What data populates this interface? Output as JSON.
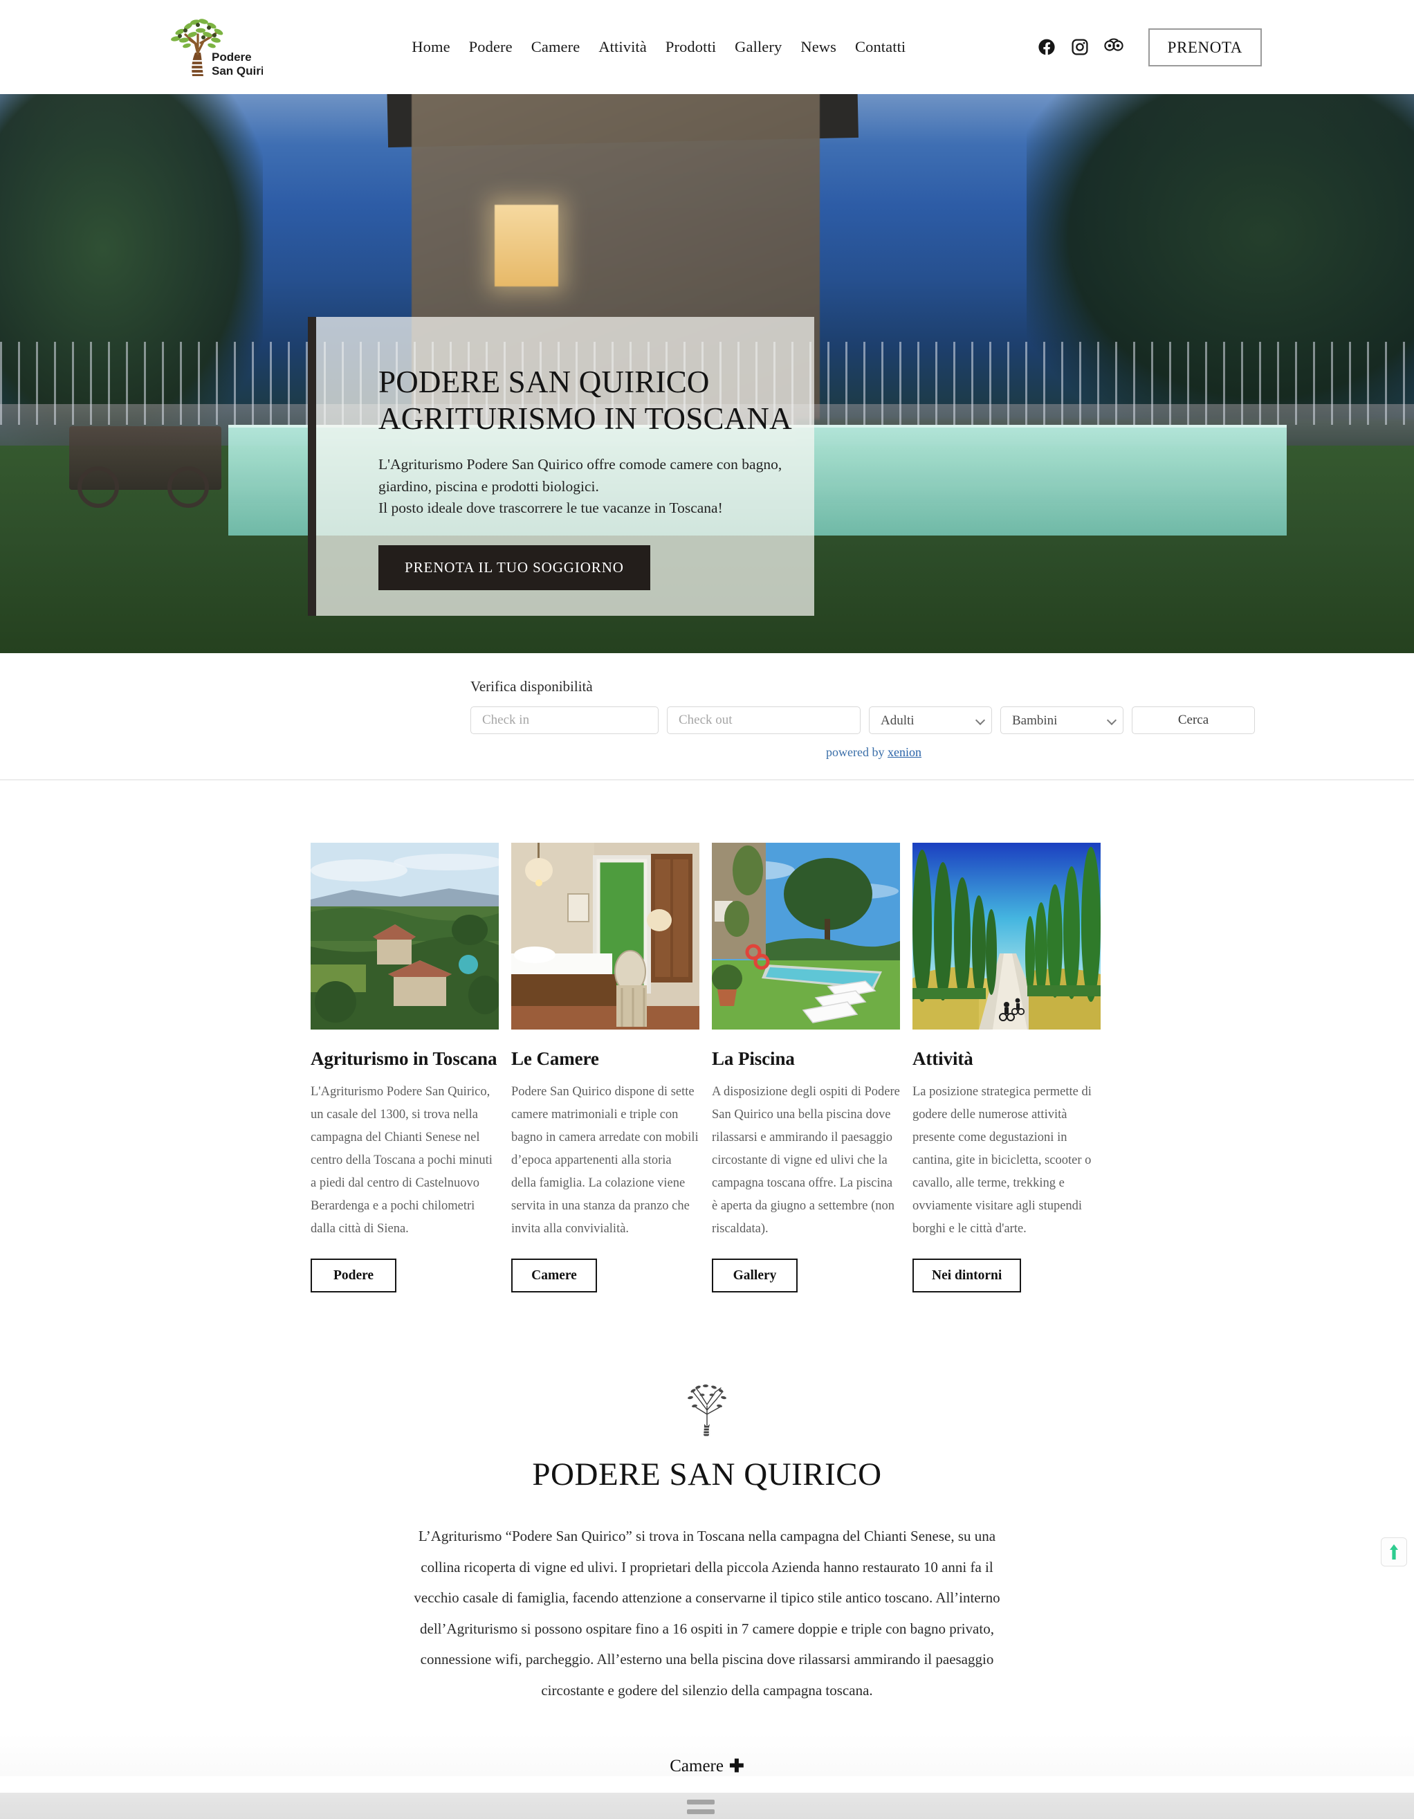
{
  "header": {
    "logo": {
      "line1": "Podere",
      "line2": "San Quirico",
      "alt": "podere-san-quirico-logo"
    },
    "nav": [
      {
        "label": "Home"
      },
      {
        "label": "Podere"
      },
      {
        "label": "Camere"
      },
      {
        "label": "Attività"
      },
      {
        "label": "Prodotti"
      },
      {
        "label": "Gallery"
      },
      {
        "label": "News"
      },
      {
        "label": "Contatti"
      }
    ],
    "social": [
      {
        "name": "facebook-icon"
      },
      {
        "name": "instagram-icon"
      },
      {
        "name": "tripadvisor-icon"
      }
    ],
    "book_button": "PRENOTA"
  },
  "hero": {
    "title": "PODERE SAN QUIRICO\nAGRITURISMO IN TOSCANA",
    "subtitle": "L'Agriturismo Podere San Quirico offre comode camere con bagno, giardino, piscina e prodotti biologici.\nIl posto ideale dove trascorrere le tue vacanze in Toscana!",
    "cta": "PRENOTA IL TUO SOGGIORNO"
  },
  "booking": {
    "label": "Verifica disponibilità",
    "checkin_placeholder": "Check in",
    "checkin_value": "",
    "checkout_placeholder": "Check out",
    "checkout_value": "",
    "adults_label": "Adulti",
    "children_label": "Bambini",
    "search_button": "Cerca",
    "powered_prefix": "powered by ",
    "powered_link": "xenion"
  },
  "cards": [
    {
      "image": "aerial-farmhouse-countryside",
      "title": "Agriturismo in Toscana",
      "text": "L'Agriturismo Podere San Quirico, un casale del 1300, si trova nella campagna del Chianti Senese nel centro della Toscana a pochi minuti a piedi dal centro di Castelnuovo Berardenga e a pochi chilometri dalla città di Siena.",
      "button": "Podere"
    },
    {
      "image": "bedroom-interior",
      "title": "Le Camere",
      "text": "Podere San Quirico dispone di sette camere matrimoniali e triple con bagno in camera arredate con mobili d’epoca appartenenti alla storia della famiglia. La colazione viene servita in una stanza da pranzo che invita alla convivialità.",
      "button": "Camere"
    },
    {
      "image": "swimming-pool-garden",
      "title": "La Piscina",
      "text": "A disposizione degli ospiti di Podere San Quirico una bella piscina dove rilassarsi e ammirando il paesaggio circostante di vigne ed ulivi che la campagna toscana offre. La piscina è aperta da giugno a settembre (non riscaldata).",
      "button": "Gallery"
    },
    {
      "image": "cypress-road-cyclists",
      "title": "Attività",
      "text": "La posizione strategica permette di godere delle numerose attività presente come degustazioni in cantina, gite in bicicletta, scooter o cavallo, alle terme, trekking e ovviamente visitare agli stupendi borghi e le città d'arte.",
      "button": "Nei dintorni"
    }
  ],
  "about": {
    "icon": "olive-tree-icon",
    "title": "PODERE SAN QUIRICO",
    "text": "L’Agriturismo “Podere San Quirico” si trova in Toscana nella campagna del Chianti Senese, su una collina ricoperta di vigne ed ulivi. I proprietari della piccola Azienda hanno restaurato 10 anni fa il vecchio casale di famiglia, facendo attenzione a conservarne il tipico stile antico toscano. All’interno dell’Agriturismo si possono ospitare fino a 16 ospiti in 7 camere doppie e triple con bagno privato, connessione wifi,  parcheggio. All’esterno una bella piscina dove rilassarsi ammirando il paesaggio circostante e godere del silenzio della campagna toscana."
  },
  "accordion": {
    "camere_label": "Camere",
    "plus": "✚"
  },
  "scroll_to_top": {
    "name": "scroll-to-top-button",
    "color": "#2ecc8f"
  },
  "colors": {
    "accent_dark": "#231e1b",
    "link_blue": "#2a63a8",
    "green": "#2ecc8f",
    "border_gray": "#d8d8d8"
  }
}
